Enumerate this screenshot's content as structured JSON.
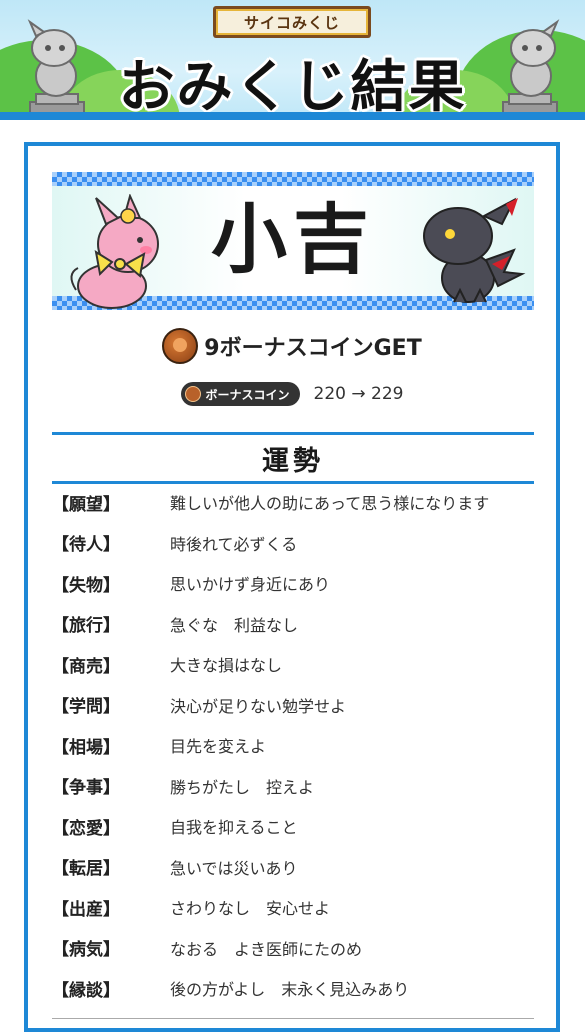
{
  "header": {
    "ribbon_label": "サイコみくじ",
    "title": "おみくじ結果"
  },
  "result": {
    "fortune": "小吉",
    "coin_get_text": "9ボーナスコインGET",
    "bonus_pill_label": "ボーナスコイン",
    "bonus_change": "220 → 229"
  },
  "luck_section": {
    "heading": "運勢",
    "items": [
      {
        "key": "【願望】",
        "value": "難しいが他人の助にあって思う様になります"
      },
      {
        "key": "【待人】",
        "value": "時後れて必ずくる"
      },
      {
        "key": "【失物】",
        "value": "思いかけず身近にあり"
      },
      {
        "key": "【旅行】",
        "value": "急ぐな　利益なし"
      },
      {
        "key": "【商売】",
        "value": "大きな損はなし"
      },
      {
        "key": "【学問】",
        "value": "決心が足りない勉学せよ"
      },
      {
        "key": "【相場】",
        "value": "目先を変えよ"
      },
      {
        "key": "【争事】",
        "value": "勝ちがたし　控えよ"
      },
      {
        "key": "【恋愛】",
        "value": "自我を抑えること"
      },
      {
        "key": "【転居】",
        "value": "急いでは災いあり"
      },
      {
        "key": "【出産】",
        "value": "さわりなし　安心せよ"
      },
      {
        "key": "【病気】",
        "value": "なおる　よき医師にたのめ"
      },
      {
        "key": "【縁談】",
        "value": "後の方がよし　末永く見込みあり"
      }
    ]
  },
  "icons": {
    "coin": "coin-icon",
    "pink_character": "pink-creature-icon",
    "dark_character": "dark-dragon-icon",
    "statue": "stone-statue-icon"
  },
  "colors": {
    "accent_blue": "#1e88d6",
    "checker_blue": "#3b8ff0",
    "grass_green": "#5cc247",
    "ribbon_brown": "#7a4a1f"
  }
}
